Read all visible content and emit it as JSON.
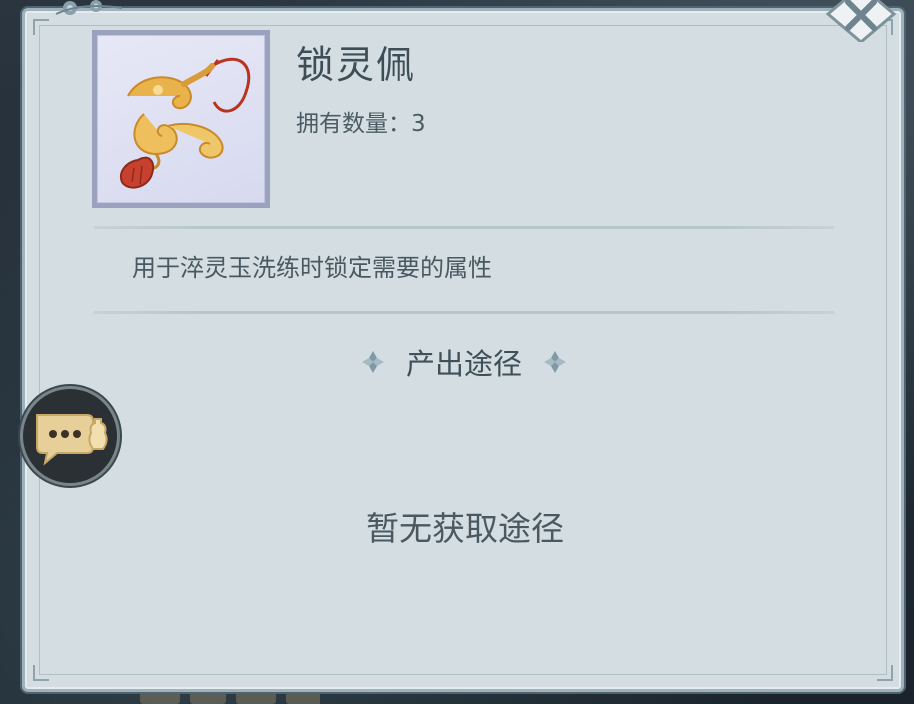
{
  "item": {
    "name": "锁灵佩",
    "owned_label": "拥有数量：",
    "owned_count": "3",
    "description": "用于淬灵玉洗练时锁定需要的属性"
  },
  "source": {
    "header": "产出途径",
    "empty_text": "暂无获取途径"
  },
  "icons": {
    "item_image": "jade-pendant-icon",
    "close": "close-icon",
    "chat": "chat-bubble-icon",
    "ornament": "diamond-ornament-icon"
  },
  "colors": {
    "panel_bg": "#d3dde2",
    "text_primary": "#3d4e57",
    "item_frame": "#9aa2bd",
    "jade_gold": "#e9b24a",
    "tassel_red": "#c8412e"
  }
}
